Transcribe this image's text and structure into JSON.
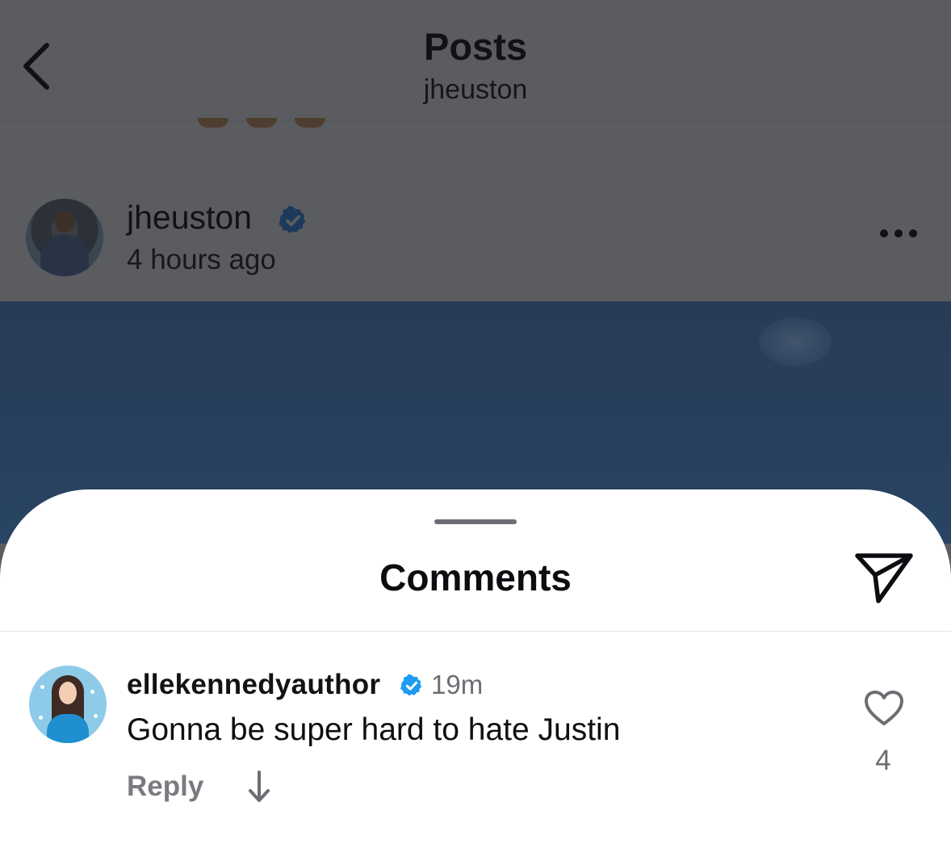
{
  "header": {
    "title": "Posts",
    "subtitle": "jheuston"
  },
  "post": {
    "username": "jheuston",
    "time": "4 hours ago",
    "verified": true
  },
  "comments_sheet": {
    "title": "Comments",
    "comments": [
      {
        "username": "ellekennedyauthor",
        "verified": true,
        "time": "19m",
        "text": "Gonna be super hard to hate Justin",
        "reply_label": "Reply",
        "likes": "4"
      }
    ]
  },
  "colors": {
    "overlay": "#5b5c60",
    "verified_blue": "#1d9bf0",
    "sheet_background": "#ffffff"
  },
  "icons": [
    "back-chevron-icon",
    "verified-badge-icon",
    "more-options-icon",
    "share-send-icon",
    "arrow-down-icon",
    "heart-icon"
  ]
}
